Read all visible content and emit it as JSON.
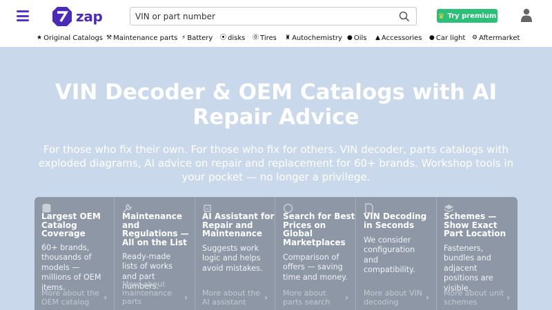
{
  "header": {
    "logo_text": "zap",
    "search": {
      "placeholder": "VIN or part number"
    },
    "premium_label": "Try premium"
  },
  "categories": [
    {
      "label": "Original Catalogs",
      "icon": "star-icon"
    },
    {
      "label": "Maintenance parts",
      "icon": "wrench-icon"
    },
    {
      "label": "Battery",
      "icon": "lightning-icon"
    },
    {
      "label": "disks",
      "icon": "disk-icon"
    },
    {
      "label": "Tires",
      "icon": "tire-icon"
    },
    {
      "label": "Autochemistry",
      "icon": "spray-bottle-icon"
    },
    {
      "label": "Oils",
      "icon": "oil-drop-icon"
    },
    {
      "label": "Accessories",
      "icon": "triangle-icon"
    },
    {
      "label": "Car light",
      "icon": "bulb-icon"
    },
    {
      "label": "Aftermarket",
      "icon": "gear-icon"
    }
  ],
  "hero": {
    "title": "VIN Decoder & OEM Catalogs with AI Repair Advice",
    "subtitle": "For those who fix their own. For those who fix for others. VIN decoder, parts catalogs with exploded diagrams, AI advice on repair and replacement for 60+ brands. Workshop tools in your pocket — no longer a privilege."
  },
  "cards": [
    {
      "title": "Largest OEM Catalog Coverage",
      "text": "60+ brands, thousands of models — millions of OEM items.",
      "more": "More about the OEM catalog",
      "icon": "database-icon"
    },
    {
      "title": "Maintenance and Regulations — All on the List",
      "text": "Ready-made lists of works and part numbers.",
      "more": "More about maintenance parts",
      "icon": "wrench-icon"
    },
    {
      "title": "AI Assistant for Repair and Maintenance",
      "text": "Suggests work logic and helps avoid mistakes.",
      "more": "More about the AI assistant",
      "icon": "ai-chip-icon"
    },
    {
      "title": "Search for Best Prices on Global Marketplaces",
      "text": "Comparison of offers — saving time and money.",
      "more": "More about parts search",
      "icon": "search-icon"
    },
    {
      "title": "VIN Decoding in Seconds",
      "text": "We consider configuration and compatibility.",
      "more": "More about VIN decoding",
      "icon": "document-icon"
    },
    {
      "title": "Schemes — Show Exact Part Location",
      "text": "Fasteners, bundles and adjacent positions are visible.",
      "more": "More about unit schemes",
      "icon": "layers-icon"
    }
  ],
  "colors": {
    "brand": "#4a2bb8",
    "premium": "#2bbf78",
    "hero_bg": "#c9d8ea",
    "card_bg": "#8d97a6"
  }
}
